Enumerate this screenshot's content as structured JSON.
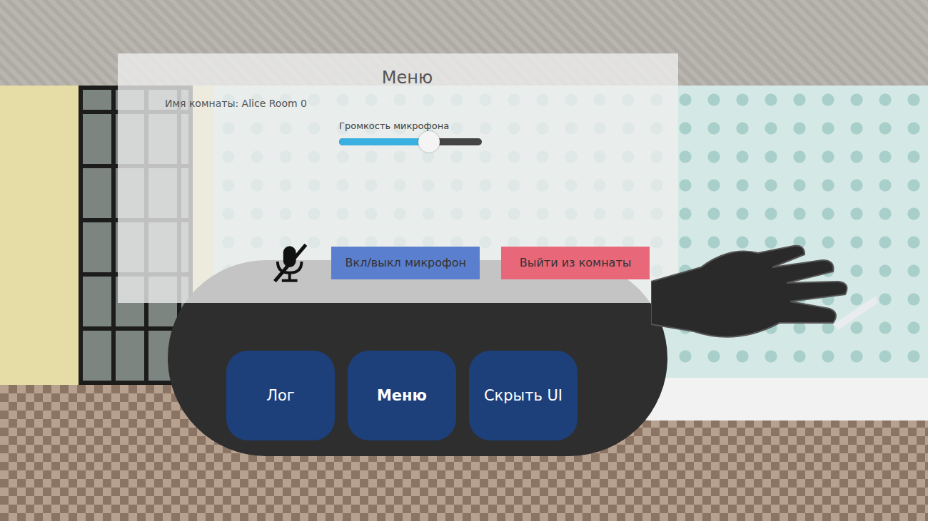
{
  "menu": {
    "title": "Меню",
    "room_label": "Имя комнаты: Alice Room 0",
    "volume": {
      "label": "Громкость микрофона",
      "level": 0.63
    },
    "microphone": {
      "muted": true
    },
    "buttons": [
      {
        "label": "Вкл/выкл микрофон",
        "color": "#5b7fcf"
      },
      {
        "label": "Выйти из комнаты",
        "color": "#e8687a"
      }
    ]
  },
  "wrist_menu": {
    "buttons": [
      {
        "label": "Лог",
        "selected": false
      },
      {
        "label": "Меню",
        "selected": true
      },
      {
        "label": "Скрыть UI",
        "selected": false
      }
    ]
  }
}
